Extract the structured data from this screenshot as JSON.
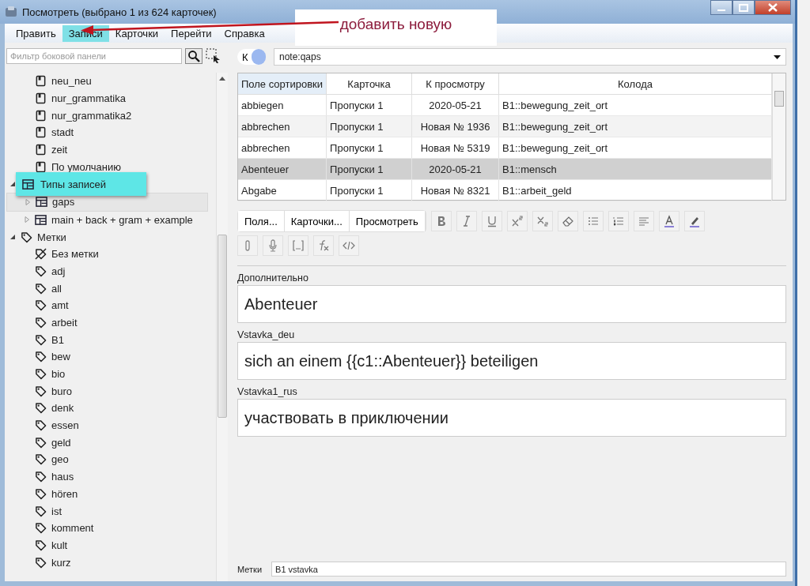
{
  "window": {
    "title": "Посмотреть (выбрано 1 из 624 карточек)"
  },
  "menu": [
    {
      "label": "Править",
      "selected": false
    },
    {
      "label": "Записи",
      "selected": true
    },
    {
      "label": "Карточки",
      "selected": false
    },
    {
      "label": "Перейти",
      "selected": false
    },
    {
      "label": "Справка",
      "selected": false
    }
  ],
  "callout": {
    "text": "добавить новую"
  },
  "sidebar": {
    "filter_placeholder": "Фильтр боковой панели",
    "tree": [
      {
        "kind": "continued",
        "children": [
          {
            "label": "neu_neu",
            "kind": "deck",
            "selected": false
          },
          {
            "label": "nur_grammatika",
            "kind": "deck",
            "selected": false
          },
          {
            "label": "nur_grammatika2",
            "kind": "deck",
            "selected": false
          },
          {
            "label": "stadt",
            "kind": "deck",
            "selected": false
          },
          {
            "label": "zeit",
            "kind": "deck",
            "selected": false
          },
          {
            "label": "По умолчанию",
            "kind": "deck",
            "selected": false
          }
        ]
      },
      {
        "kind": "covered",
        "expanded": true,
        "children": [
          {
            "label": "gaps",
            "kind": "notetype",
            "expanded": false,
            "selected": true
          },
          {
            "label": "main + back + gram + example",
            "kind": "notetype",
            "expanded": false,
            "selected": false
          }
        ]
      },
      {
        "label": "Метки",
        "kind": "tag",
        "expanded": true,
        "selected": false,
        "children": [
          {
            "label": "Без метки",
            "kind": "untagged",
            "selected": false
          },
          {
            "label": "adj",
            "kind": "tag",
            "selected": false
          },
          {
            "label": "all",
            "kind": "tag",
            "selected": false
          },
          {
            "label": "amt",
            "kind": "tag",
            "selected": false
          },
          {
            "label": "arbeit",
            "kind": "tag",
            "selected": false
          },
          {
            "label": "B1",
            "kind": "tag",
            "selected": false
          },
          {
            "label": "bew",
            "kind": "tag",
            "selected": false
          },
          {
            "label": "bio",
            "kind": "tag",
            "selected": false
          },
          {
            "label": "buro",
            "kind": "tag",
            "selected": false
          },
          {
            "label": "denk",
            "kind": "tag",
            "selected": false
          },
          {
            "label": "essen",
            "kind": "tag",
            "selected": false
          },
          {
            "label": "geld",
            "kind": "tag",
            "selected": false
          },
          {
            "label": "geo",
            "kind": "tag",
            "selected": false
          },
          {
            "label": "haus",
            "kind": "tag",
            "selected": false
          },
          {
            "label": "hören",
            "kind": "tag",
            "selected": false
          },
          {
            "label": "ist",
            "kind": "tag",
            "selected": false
          },
          {
            "label": "komment",
            "kind": "tag",
            "selected": false
          },
          {
            "label": "kult",
            "kind": "tag",
            "selected": false
          },
          {
            "label": "kurz",
            "kind": "tag",
            "selected": false
          }
        ]
      }
    ]
  },
  "tooltip": {
    "text": "Типы записей"
  },
  "search": {
    "toggle_label": "К",
    "value": "note:qaps"
  },
  "table": {
    "columns": [
      "Поле сортировки",
      "Карточка",
      "К просмотру",
      "Колода"
    ],
    "rows": [
      {
        "cells": [
          "abbiegen",
          "Пропуски 1",
          "2020-05-21",
          "B1::bewegung_zeit_ort"
        ],
        "selected": false
      },
      {
        "cells": [
          "abbrechen",
          "Пропуски 1",
          "Новая № 1936",
          "B1::bewegung_zeit_ort"
        ],
        "selected": false
      },
      {
        "cells": [
          "abbrechen",
          "Пропуски 1",
          "Новая № 5319",
          "B1::bewegung_zeit_ort"
        ],
        "selected": false
      },
      {
        "cells": [
          "Abenteuer",
          "Пропуски 1",
          "2020-05-21",
          "B1::mensch"
        ],
        "selected": true
      },
      {
        "cells": [
          "Abgabe",
          "Пропуски 1",
          "Новая № 8321",
          "B1::arbeit_geld"
        ],
        "selected": false
      }
    ]
  },
  "editor": {
    "buttons": [
      "Поля...",
      "Карточки...",
      "Просмотреть"
    ],
    "fields": [
      {
        "label": "Дополнительно",
        "value": "Abenteuer"
      },
      {
        "label": "Vstavka_deu",
        "value": "sich an einem {{c1::Abenteuer}} beteiligen"
      },
      {
        "label": "Vstavka1_rus",
        "value": "участвовать в приключении"
      }
    ],
    "tags": {
      "label": "Метки",
      "value": "B1 vstavka"
    }
  }
}
